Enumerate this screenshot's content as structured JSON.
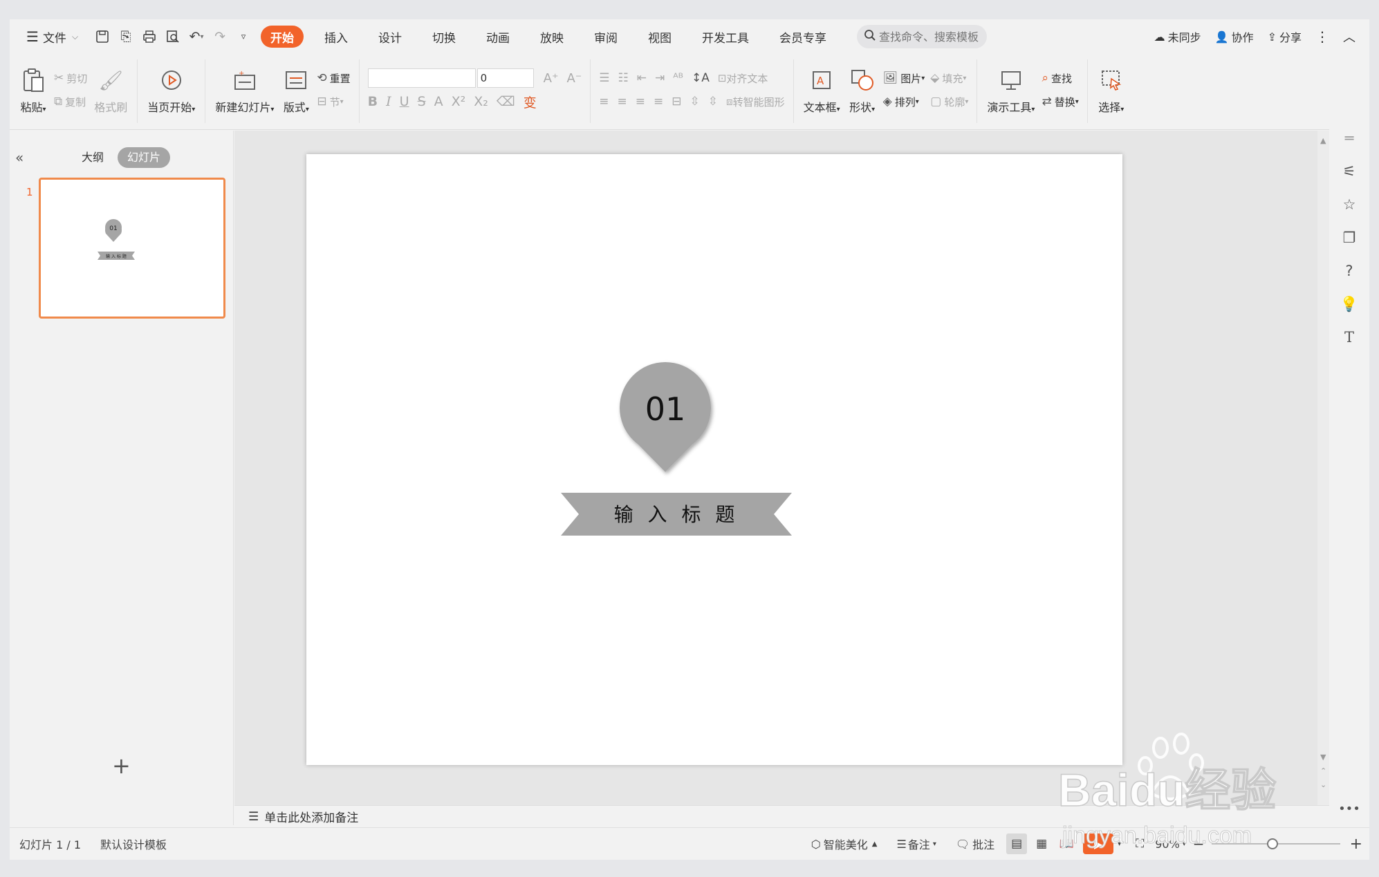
{
  "menubar": {
    "file_label": "文件",
    "tabs": [
      "开始",
      "插入",
      "设计",
      "切换",
      "动画",
      "放映",
      "审阅",
      "视图",
      "开发工具",
      "会员专享"
    ],
    "search_placeholder": "查找命令、搜索模板",
    "sync_label": "未同步",
    "collab_label": "协作",
    "share_label": "分享"
  },
  "ribbon": {
    "paste": "粘贴",
    "cut": "剪切",
    "copy": "复制",
    "format_painter": "格式刷",
    "play_current": "当页开始",
    "new_slide": "新建幻灯片",
    "layout": "版式",
    "reset": "重置",
    "section": "节",
    "font_size_value": "0",
    "align_text": "对齐文本",
    "convert_smartart": "转智能图形",
    "textbox": "文本框",
    "shape": "形状",
    "picture": "图片",
    "fill": "填充",
    "arrange": "排列",
    "outline": "轮廓",
    "presentation_tools": "演示工具",
    "find": "查找",
    "replace": "替换",
    "select": "选择"
  },
  "leftpanel": {
    "tab_outline": "大纲",
    "tab_slides": "幻灯片",
    "slide_number": "1",
    "thumb_badge": "01",
    "thumb_title": "输 入 标 题"
  },
  "slide": {
    "badge_number": "01",
    "title_text": "输  入  标  题"
  },
  "notes_placeholder": "单击此处添加备注",
  "status": {
    "slide_counter": "幻灯片 1 / 1",
    "template": "默认设计模板",
    "beautify": "智能美化",
    "notes": "备注",
    "comments": "批注",
    "zoom": "90%"
  },
  "watermark": {
    "brand": "Baidu经验",
    "url": "jingyan.baidu.com"
  },
  "colors": {
    "accent": "#f2632a",
    "shape_gray": "#a5a5a5",
    "thumb_border": "#f08a4b"
  }
}
